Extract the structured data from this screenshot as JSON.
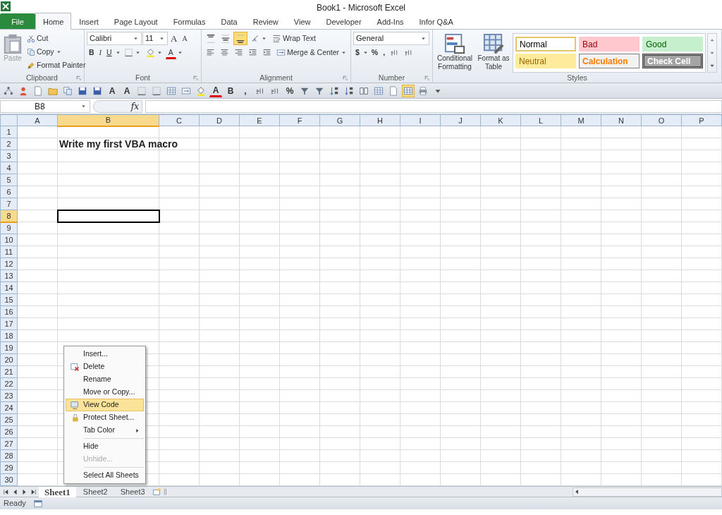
{
  "window": {
    "title": "Book1  -  Microsoft Excel"
  },
  "tabs": [
    {
      "label": "File",
      "kind": "file",
      "selected": false
    },
    {
      "label": "Home",
      "kind": "tab",
      "selected": true
    },
    {
      "label": "Insert",
      "kind": "tab",
      "selected": false
    },
    {
      "label": "Page Layout",
      "kind": "tab",
      "selected": false
    },
    {
      "label": "Formulas",
      "kind": "tab",
      "selected": false
    },
    {
      "label": "Data",
      "kind": "tab",
      "selected": false
    },
    {
      "label": "Review",
      "kind": "tab",
      "selected": false
    },
    {
      "label": "View",
      "kind": "tab",
      "selected": false
    },
    {
      "label": "Developer",
      "kind": "tab",
      "selected": false
    },
    {
      "label": "Add-Ins",
      "kind": "tab",
      "selected": false
    },
    {
      "label": "Infor Q&A",
      "kind": "tab",
      "selected": false
    }
  ],
  "ribbon": {
    "groups": [
      {
        "kind": "clipboard",
        "label": "Clipboard",
        "paste": {
          "label": "Paste",
          "disabled": true
        },
        "cut": "Cut",
        "copy": "Copy",
        "format_painter": "Format Painter"
      },
      {
        "kind": "font",
        "label": "Font",
        "font_name": "Calibri",
        "font_size": "11",
        "grow": "A",
        "shrink": "A",
        "bold": "B",
        "italic": "I",
        "underline": "U",
        "font_color": "A"
      },
      {
        "kind": "alignment",
        "label": "Alignment",
        "vertical": [
          {
            "selected": false
          },
          {
            "selected": false
          },
          {
            "selected": true
          }
        ],
        "wrap_text": "Wrap Text",
        "merge": "Merge & Center"
      },
      {
        "kind": "number",
        "label": "Number",
        "format": "General",
        "currency": "$",
        "percent": "%",
        "comma": ","
      },
      {
        "kind": "styles",
        "label": "Styles",
        "conditional": "Conditional Formatting",
        "format_table": "Format as Table",
        "cell_styles": [
          {
            "kind": "normal",
            "text": "Normal",
            "selected": true
          },
          {
            "kind": "bad",
            "text": "Bad",
            "selected": false
          },
          {
            "kind": "good",
            "text": "Good",
            "selected": false
          },
          {
            "kind": "neutral",
            "text": "Neutral",
            "selected": false
          },
          {
            "kind": "calculation",
            "text": "Calculation",
            "selected": false
          },
          {
            "kind": "check",
            "text": "Check Cell",
            "selected": false
          }
        ]
      }
    ]
  },
  "quick_toolbar": [
    {
      "kind": "icon",
      "on": false
    },
    {
      "kind": "icon",
      "on": false
    },
    {
      "kind": "icon",
      "on": false
    },
    {
      "kind": "icon",
      "on": false
    },
    {
      "kind": "icon",
      "on": false
    },
    {
      "kind": "icon",
      "on": false
    },
    {
      "kind": "icon",
      "on": false
    },
    {
      "kind": "text",
      "text": "A",
      "on": false
    },
    {
      "kind": "text",
      "text": "A",
      "on": false
    },
    {
      "kind": "icon",
      "on": false
    },
    {
      "kind": "icon",
      "on": false
    },
    {
      "kind": "icon",
      "on": false
    },
    {
      "kind": "icon",
      "on": false
    },
    {
      "kind": "icon",
      "on": false
    },
    {
      "kind": "font_color",
      "text": "A",
      "on": false
    },
    {
      "kind": "text",
      "text": "B",
      "on": false
    },
    {
      "kind": "text",
      "text": ",",
      "on": false
    },
    {
      "kind": "icon",
      "on": false
    },
    {
      "kind": "icon",
      "on": false
    },
    {
      "kind": "text",
      "text": "%",
      "on": false
    },
    {
      "kind": "icon",
      "on": false
    },
    {
      "kind": "icon",
      "on": false
    },
    {
      "kind": "icon",
      "on": false
    },
    {
      "kind": "icon",
      "on": false
    },
    {
      "kind": "icon",
      "on": false
    },
    {
      "kind": "icon",
      "on": false
    },
    {
      "kind": "icon",
      "on": false
    },
    {
      "kind": "icon",
      "on": true
    },
    {
      "kind": "icon",
      "on": false
    },
    {
      "kind": "icon",
      "on": false
    }
  ],
  "formula_bar": {
    "name_box": "B8",
    "function_label": "fx"
  },
  "sheet": {
    "columns": [
      {
        "label": "A",
        "selected": false
      },
      {
        "label": "B",
        "selected": true
      },
      {
        "label": "C",
        "selected": false
      },
      {
        "label": "D",
        "selected": false
      },
      {
        "label": "E",
        "selected": false
      },
      {
        "label": "F",
        "selected": false
      },
      {
        "label": "G",
        "selected": false
      },
      {
        "label": "H",
        "selected": false
      },
      {
        "label": "I",
        "selected": false
      },
      {
        "label": "J",
        "selected": false
      },
      {
        "label": "K",
        "selected": false
      },
      {
        "label": "L",
        "selected": false
      },
      {
        "label": "M",
        "selected": false
      },
      {
        "label": "N",
        "selected": false
      },
      {
        "label": "O",
        "selected": false
      },
      {
        "label": "P",
        "selected": false
      }
    ],
    "rows": [
      {
        "label": "1",
        "selected": false
      },
      {
        "label": "2",
        "selected": false,
        "cells": [
          null,
          {
            "text": "Write my first VBA macro",
            "bold": true
          }
        ]
      },
      {
        "label": "3",
        "selected": false
      },
      {
        "label": "4",
        "selected": false
      },
      {
        "label": "5",
        "selected": false
      },
      {
        "label": "6",
        "selected": false
      },
      {
        "label": "7",
        "selected": false
      },
      {
        "label": "8",
        "selected": true
      },
      {
        "label": "9",
        "selected": false
      },
      {
        "label": "10",
        "selected": false
      },
      {
        "label": "11",
        "selected": false
      },
      {
        "label": "12",
        "selected": false
      },
      {
        "label": "13",
        "selected": false
      },
      {
        "label": "14",
        "selected": false
      },
      {
        "label": "15",
        "selected": false
      },
      {
        "label": "16",
        "selected": false
      },
      {
        "label": "17",
        "selected": false
      },
      {
        "label": "18",
        "selected": false
      },
      {
        "label": "19",
        "selected": false
      },
      {
        "label": "20",
        "selected": false
      },
      {
        "label": "21",
        "selected": false
      },
      {
        "label": "22",
        "selected": false
      },
      {
        "label": "23",
        "selected": false
      },
      {
        "label": "24",
        "selected": false
      },
      {
        "label": "25",
        "selected": false
      },
      {
        "label": "26",
        "selected": false
      },
      {
        "label": "27",
        "selected": false
      },
      {
        "label": "28",
        "selected": false
      },
      {
        "label": "29",
        "selected": false
      },
      {
        "label": "30",
        "selected": false
      }
    ]
  },
  "context_menu": [
    {
      "kind": "item",
      "label": "Insert...",
      "selected": false,
      "disabled": false,
      "submenu": false
    },
    {
      "kind": "item",
      "label": "Delete",
      "selected": false,
      "disabled": false,
      "submenu": false
    },
    {
      "kind": "item",
      "label": "Rename",
      "selected": false,
      "disabled": false,
      "submenu": false
    },
    {
      "kind": "item",
      "label": "Move or Copy...",
      "selected": false,
      "disabled": false,
      "submenu": false
    },
    {
      "kind": "item",
      "label": "View Code",
      "selected": true,
      "disabled": false,
      "submenu": false
    },
    {
      "kind": "item",
      "label": "Protect Sheet...",
      "selected": false,
      "disabled": false,
      "submenu": false
    },
    {
      "kind": "item",
      "label": "Tab Color",
      "selected": false,
      "disabled": false,
      "submenu": true
    },
    {
      "kind": "separator"
    },
    {
      "kind": "item",
      "label": "Hide",
      "selected": false,
      "disabled": false,
      "submenu": false
    },
    {
      "kind": "item",
      "label": "Unhide...",
      "selected": false,
      "disabled": true,
      "submenu": false
    },
    {
      "kind": "separator"
    },
    {
      "kind": "item",
      "label": "Select All Sheets",
      "selected": false,
      "disabled": false,
      "submenu": false
    }
  ],
  "sheet_tabs": [
    {
      "label": "Sheet1",
      "selected": true
    },
    {
      "label": "Sheet2",
      "selected": false
    },
    {
      "label": "Sheet3",
      "selected": false
    }
  ],
  "status_bar": {
    "text": "Ready"
  }
}
